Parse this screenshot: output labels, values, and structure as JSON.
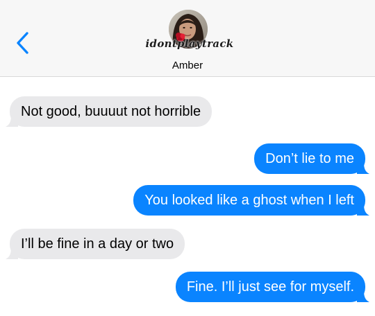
{
  "header": {
    "back_icon": "chevron-left-icon",
    "avatar_handle": "idontplaytrack",
    "contact_name": "Amber",
    "accent_color": "#0a84ff"
  },
  "messages": [
    {
      "direction": "incoming",
      "text": "Not good, buuuut not horrible"
    },
    {
      "direction": "outgoing",
      "text": "Don’t lie to me"
    },
    {
      "direction": "outgoing",
      "text": "You looked like a ghost when I left"
    },
    {
      "direction": "incoming",
      "text": "I’ll be fine in a day or two"
    },
    {
      "direction": "outgoing",
      "text": "Fine. I’ll just see for myself."
    }
  ],
  "colors": {
    "incoming_bubble": "#e9e9eb",
    "outgoing_bubble": "#0a84ff",
    "header_background": "#f7f7f7"
  }
}
